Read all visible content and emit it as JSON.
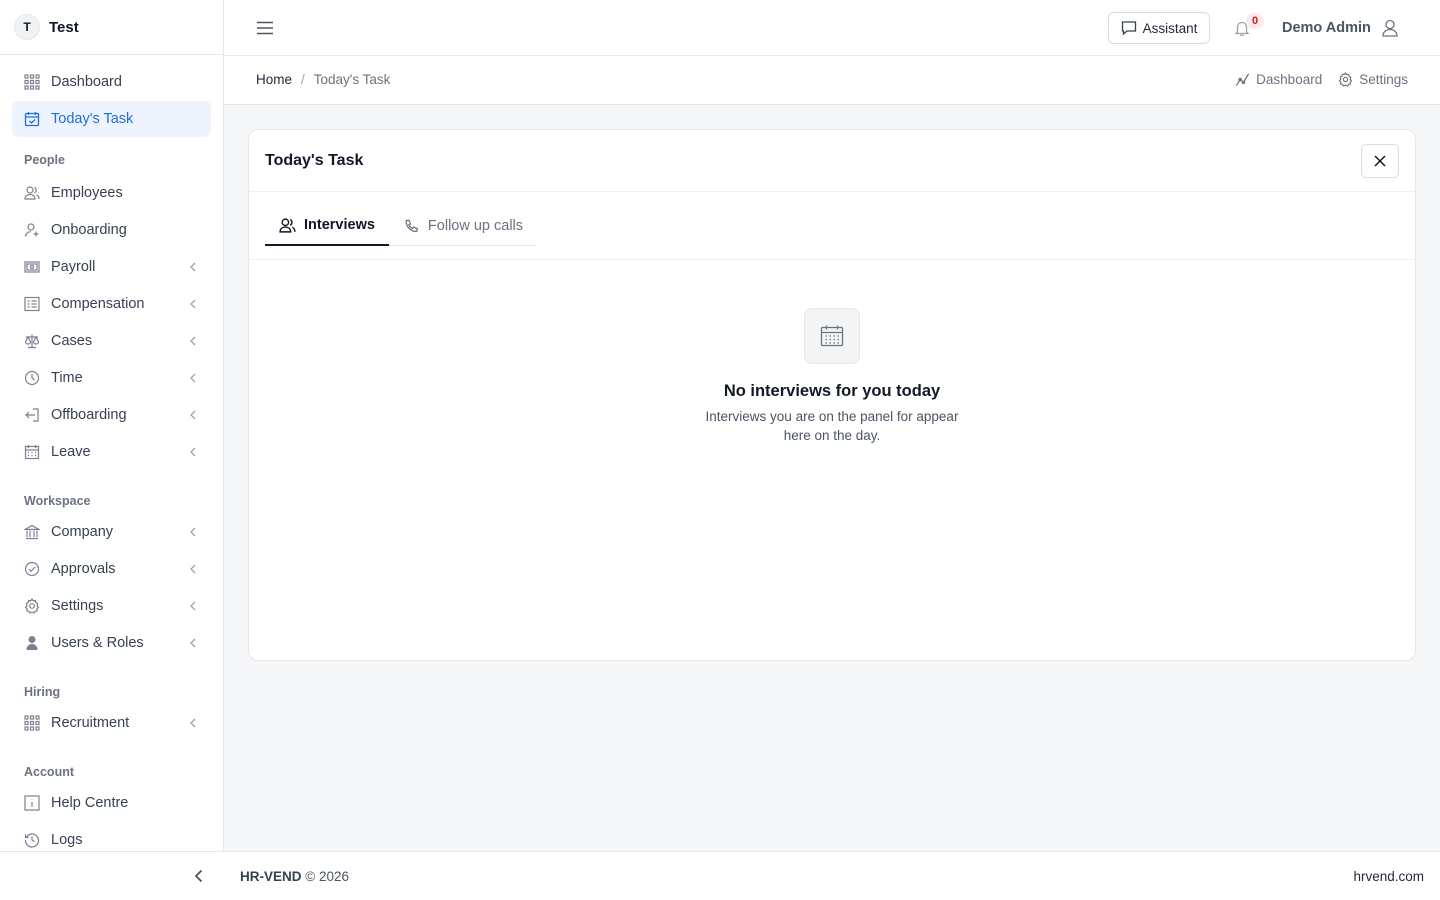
{
  "brand": {
    "initial": "T",
    "name": "Test"
  },
  "sidebar": {
    "top": [
      {
        "label": "Dashboard",
        "icon": "grid-icon"
      },
      {
        "label": "Today's Task",
        "icon": "calendar-check-icon",
        "active": true
      }
    ],
    "sections": [
      {
        "label": "People",
        "items": [
          {
            "label": "Employees",
            "icon": "users-icon"
          },
          {
            "label": "Onboarding",
            "icon": "user-plus-icon"
          },
          {
            "label": "Payroll",
            "icon": "banknote-icon",
            "chevron": true
          },
          {
            "label": "Compensation",
            "icon": "list-icon",
            "chevron": true
          },
          {
            "label": "Cases",
            "icon": "scale-icon",
            "chevron": true
          },
          {
            "label": "Time",
            "icon": "clock-icon",
            "chevron": true
          },
          {
            "label": "Offboarding",
            "icon": "log-out-icon",
            "chevron": true
          },
          {
            "label": "Leave",
            "icon": "calendar-icon",
            "chevron": true
          }
        ]
      },
      {
        "label": "Workspace",
        "items": [
          {
            "label": "Company",
            "icon": "bank-icon",
            "chevron": true
          },
          {
            "label": "Approvals",
            "icon": "check-circle-icon",
            "chevron": true
          },
          {
            "label": "Settings",
            "icon": "gear-icon",
            "chevron": true
          },
          {
            "label": "Users & Roles",
            "icon": "user-shield-icon",
            "chevron": true
          }
        ]
      },
      {
        "label": "Hiring",
        "items": [
          {
            "label": "Recruitment",
            "icon": "grid-icon",
            "chevron": true
          }
        ]
      },
      {
        "label": "Account",
        "items": [
          {
            "label": "Help Centre",
            "icon": "info-icon"
          },
          {
            "label": "Logs",
            "icon": "history-icon"
          }
        ]
      }
    ]
  },
  "topbar": {
    "assistant_label": "Assistant",
    "notification_count": "0",
    "user_name": "Demo Admin"
  },
  "breadcrumb": {
    "home": "Home",
    "separator": "/",
    "current": "Today's Task",
    "links": [
      "Dashboard",
      "Settings"
    ]
  },
  "card": {
    "title": "Today's Task",
    "tabs": [
      {
        "label": "Interviews",
        "active": true
      },
      {
        "label": "Follow up calls",
        "active": false
      }
    ],
    "empty": {
      "title": "No interviews for you today",
      "description": "Interviews you are on the panel for appear here on the day."
    }
  },
  "footer": {
    "brand": "HR-VEND",
    "copyright": "© 2026",
    "site": "hrvend.com"
  },
  "colors": {
    "accent": "#1d6fe0",
    "active_bg": "#eef4fe",
    "badge_text": "#d11d1d"
  }
}
